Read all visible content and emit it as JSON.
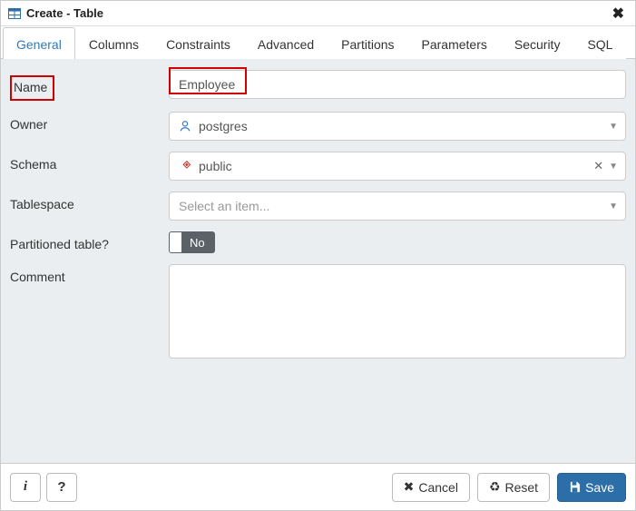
{
  "title": "Create - Table",
  "tabs": [
    "General",
    "Columns",
    "Constraints",
    "Advanced",
    "Partitions",
    "Parameters",
    "Security",
    "SQL"
  ],
  "active_tab_index": 0,
  "fields": {
    "name": {
      "label": "Name",
      "value": "Employee"
    },
    "owner": {
      "label": "Owner",
      "value": "postgres"
    },
    "schema": {
      "label": "Schema",
      "value": "public"
    },
    "tablespace": {
      "label": "Tablespace",
      "placeholder": "Select an item..."
    },
    "partitioned": {
      "label": "Partitioned table?",
      "value_label": "No"
    },
    "comment": {
      "label": "Comment",
      "value": ""
    }
  },
  "footer": {
    "info_label": "i",
    "help_label": "?",
    "cancel": "Cancel",
    "reset": "Reset",
    "save": "Save"
  },
  "colors": {
    "primary": "#2b6ea8",
    "tab_active": "#337ab7",
    "highlight": "#d10000"
  }
}
